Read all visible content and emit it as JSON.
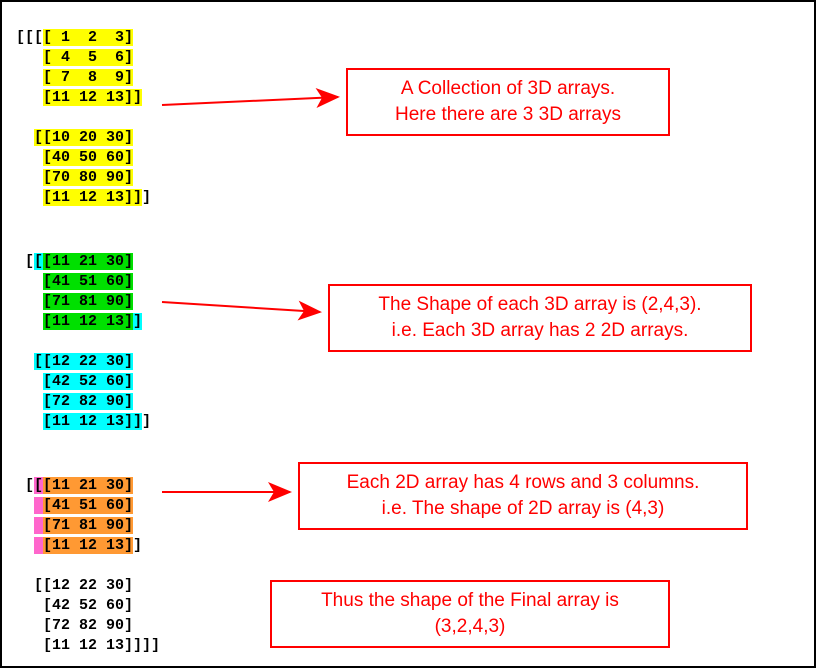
{
  "arrays": {
    "block1": {
      "a": [
        "[[[[ 1  2  3]",
        "   [ 4  5  6]",
        "   [ 7  8  9]",
        "   [11 12 13]]"
      ],
      "b": [
        "  [[10 20 30]",
        "   [40 50 60]",
        "   [70 80 90]",
        "   [11 12 13]]]"
      ]
    },
    "block2": {
      "a": [
        " [[[11 21 30]",
        "   [41 51 60]",
        "   [71 81 90]",
        "   [11 12 13]]"
      ],
      "b": [
        "  [[12 22 30]",
        "   [42 52 60]",
        "   [72 82 90]",
        "   [11 12 13]]]"
      ]
    },
    "block3": {
      "a": [
        " [[[11 21 30]",
        "   [41 51 60]",
        "   [71 81 90]",
        "   [11 12 13]]"
      ],
      "b": [
        "  [[12 22 30]",
        "   [42 52 60]",
        "   [72 82 90]",
        "   [11 12 13]]]]"
      ]
    }
  },
  "callouts": {
    "c1l1": "A Collection of 3D arrays.",
    "c1l2": "Here there are 3 3D arrays",
    "c2l1": "The Shape of each 3D array is (2,4,3).",
    "c2l2": "i.e. Each 3D array has 2 2D arrays.",
    "c3l1": "Each 2D array has 4 rows and 3 columns.",
    "c3l2": "i.e. The shape of 2D array is (4,3)",
    "c4l1": "Thus the shape of the Final array is",
    "c4l2": "(3,2,4,3)"
  },
  "chart_data": {
    "type": "table",
    "description": "Diagram explaining a 4-dimensional numpy-style array of shape (3,2,4,3)",
    "final_shape": [
      3,
      2,
      4,
      3
    ],
    "array_3d_count": 3,
    "array_3d_shape": [
      2,
      4,
      3
    ],
    "array_2d_shape": [
      4,
      3
    ],
    "data": [
      [
        [
          [
            1,
            2,
            3
          ],
          [
            4,
            5,
            6
          ],
          [
            7,
            8,
            9
          ],
          [
            11,
            12,
            13
          ]
        ],
        [
          [
            10,
            20,
            30
          ],
          [
            40,
            50,
            60
          ],
          [
            70,
            80,
            90
          ],
          [
            11,
            12,
            13
          ]
        ]
      ],
      [
        [
          [
            11,
            21,
            30
          ],
          [
            41,
            51,
            60
          ],
          [
            71,
            81,
            90
          ],
          [
            11,
            12,
            13
          ]
        ],
        [
          [
            12,
            22,
            30
          ],
          [
            42,
            52,
            60
          ],
          [
            72,
            82,
            90
          ],
          [
            11,
            12,
            13
          ]
        ]
      ],
      [
        [
          [
            11,
            21,
            30
          ],
          [
            41,
            51,
            60
          ],
          [
            71,
            81,
            90
          ],
          [
            11,
            12,
            13
          ]
        ],
        [
          [
            12,
            22,
            30
          ],
          [
            42,
            52,
            60
          ],
          [
            72,
            82,
            90
          ],
          [
            11,
            12,
            13
          ]
        ]
      ]
    ],
    "annotations": [
      "A Collection of 3D arrays. Here there are 3 3D arrays",
      "The Shape of each 3D array is (2,4,3). i.e. Each 3D array has 2 2D arrays.",
      "Each 2D array has 4 rows and 3 columns. i.e. The shape of 2D array is (4,3)",
      "Thus the shape of the Final array is (3,2,4,3)"
    ]
  }
}
